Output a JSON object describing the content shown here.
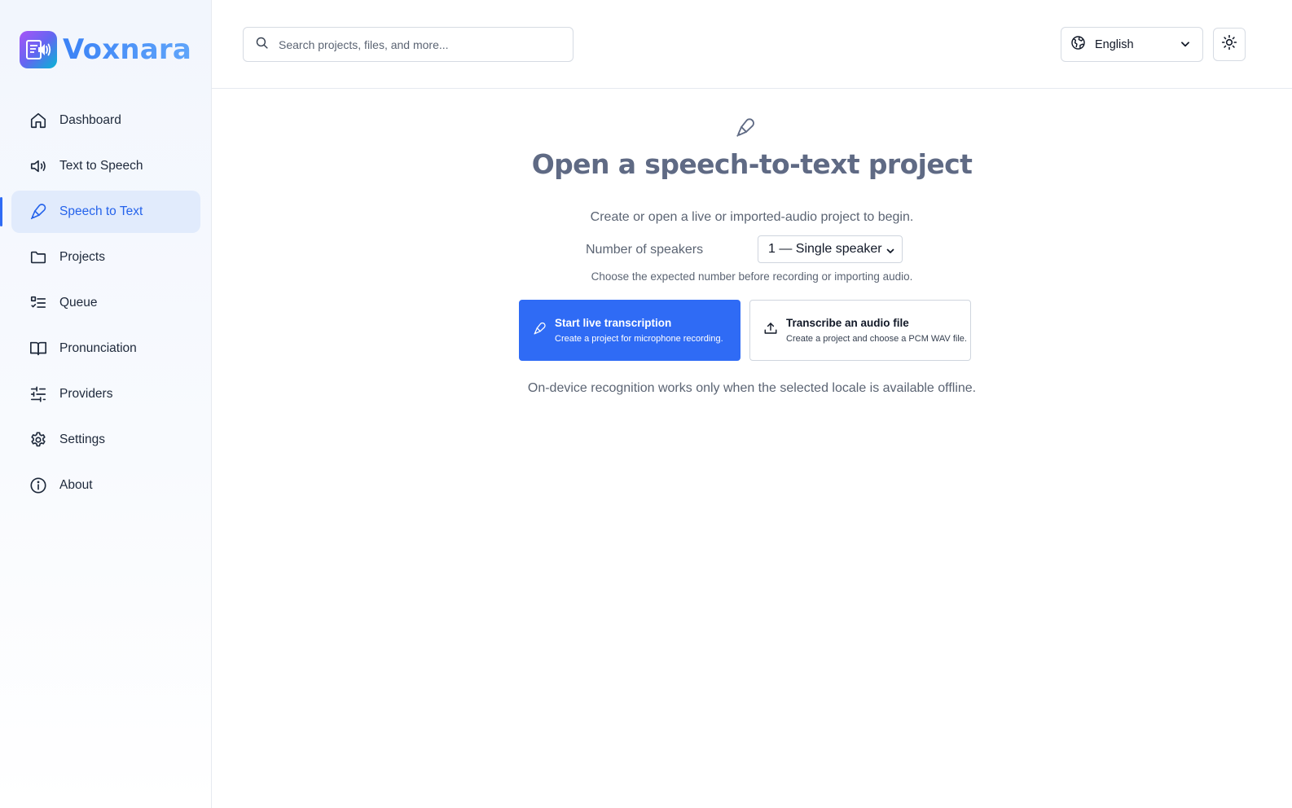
{
  "app": {
    "name": "Voxnara"
  },
  "sidebar": {
    "items": [
      {
        "label": "Dashboard",
        "icon": "home-icon"
      },
      {
        "label": "Text to Speech",
        "icon": "speaker-icon"
      },
      {
        "label": "Speech to Text",
        "icon": "microphone-icon",
        "active": true
      },
      {
        "label": "Projects",
        "icon": "folder-icon"
      },
      {
        "label": "Queue",
        "icon": "list-check-icon"
      },
      {
        "label": "Pronunciation",
        "icon": "book-icon"
      },
      {
        "label": "Providers",
        "icon": "sliders-icon"
      },
      {
        "label": "Settings",
        "icon": "gear-icon"
      },
      {
        "label": "About",
        "icon": "info-icon"
      }
    ]
  },
  "header": {
    "search": {
      "placeholder": "Search projects, files, and more..."
    },
    "language": {
      "selected": "English",
      "icon": "globe-icon"
    },
    "theme_toggle": {
      "icon": "sun-icon"
    }
  },
  "main": {
    "title": "Open a speech-to-text project",
    "subtitle": "Create or open a live or imported-audio project to begin.",
    "speakers": {
      "label": "Number of speakers",
      "selected": "1 — Single speaker",
      "hint": "Choose the expected number before recording or importing audio."
    },
    "actions": {
      "live": {
        "title": "Start live transcription",
        "description": "Create a project for microphone recording."
      },
      "file": {
        "title": "Transcribe an audio file",
        "description": "Create a project and choose a PCM WAV file."
      }
    },
    "footnote": "On-device recognition works only when the selected locale is available offline."
  },
  "colors": {
    "accent": "#2f6bf5",
    "active_bg": "#e1ebfc",
    "title": "#5f6a84",
    "muted_text": "#5b6473"
  }
}
